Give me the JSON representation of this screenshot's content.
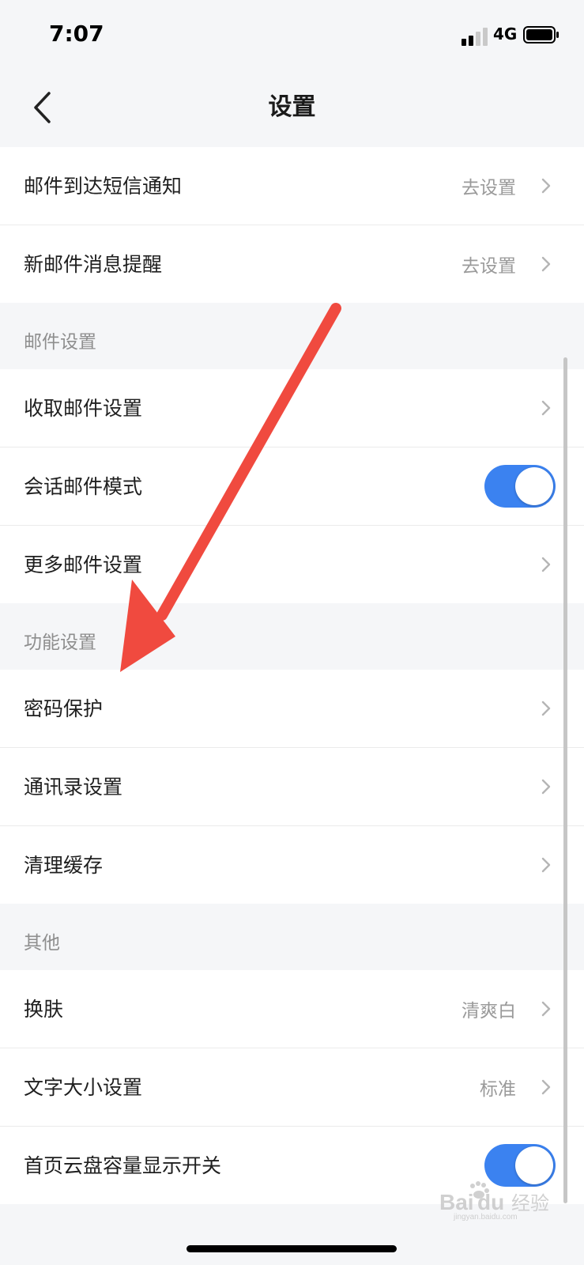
{
  "status_bar": {
    "time": "7:07",
    "network": "4G"
  },
  "nav": {
    "title": "设置"
  },
  "sections": [
    {
      "title": "",
      "rows": [
        {
          "name": "row-mail-sms-notify",
          "label": "邮件到达短信通知",
          "value": "去设置",
          "type": "link"
        },
        {
          "name": "row-new-mail-reminder",
          "label": "新邮件消息提醒",
          "value": "去设置",
          "type": "link"
        }
      ]
    },
    {
      "title": "邮件设置",
      "rows": [
        {
          "name": "row-receive-mail-settings",
          "label": "收取邮件设置",
          "type": "link"
        },
        {
          "name": "row-conversation-mode",
          "label": "会话邮件模式",
          "type": "toggle",
          "on": true
        },
        {
          "name": "row-more-mail-settings",
          "label": "更多邮件设置",
          "type": "link"
        }
      ]
    },
    {
      "title": "功能设置",
      "rows": [
        {
          "name": "row-password-protection",
          "label": "密码保护",
          "type": "link"
        },
        {
          "name": "row-contacts-settings",
          "label": "通讯录设置",
          "type": "link"
        },
        {
          "name": "row-clear-cache",
          "label": "清理缓存",
          "type": "link"
        }
      ]
    },
    {
      "title": "其他",
      "rows": [
        {
          "name": "row-skin",
          "label": "换肤",
          "value": "清爽白",
          "type": "link"
        },
        {
          "name": "row-font-size",
          "label": "文字大小设置",
          "value": "标准",
          "type": "link"
        },
        {
          "name": "row-cloud-capacity-switch",
          "label": "首页云盘容量显示开关",
          "type": "toggle",
          "on": true
        }
      ]
    }
  ],
  "watermark": {
    "text": "Baidu经验",
    "subtext": "jingyan.baidu.com"
  },
  "colors": {
    "accent": "#3b82f0",
    "arrow": "#f04a3f",
    "background": "#f5f6f8"
  }
}
